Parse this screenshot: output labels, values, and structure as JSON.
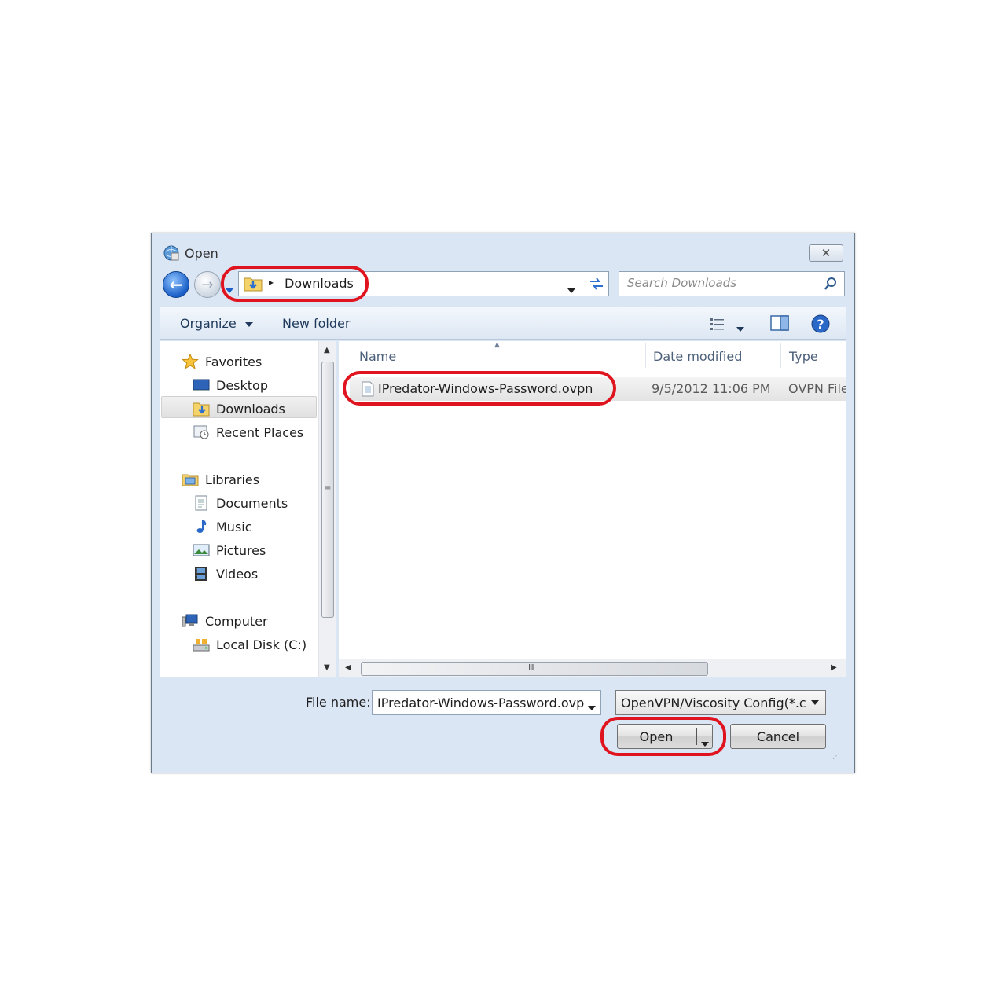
{
  "window": {
    "title": "Open"
  },
  "address": {
    "crumb_separator": "▸",
    "current_folder": "Downloads"
  },
  "search": {
    "placeholder": "Search Downloads"
  },
  "toolbar": {
    "organize_label": "Organize",
    "new_folder_label": "New folder"
  },
  "nav": {
    "groups": [
      {
        "label": "Favorites",
        "items": [
          "Desktop",
          "Downloads",
          "Recent Places"
        ]
      },
      {
        "label": "Libraries",
        "items": [
          "Documents",
          "Music",
          "Pictures",
          "Videos"
        ]
      },
      {
        "label": "Computer",
        "items": [
          "Local Disk (C:)"
        ]
      }
    ]
  },
  "columns": {
    "name": "Name",
    "date": "Date modified",
    "type": "Type"
  },
  "files": [
    {
      "name": "IPredator-Windows-Password.ovpn",
      "date": "9/5/2012 11:06 PM",
      "type": "OVPN File"
    }
  ],
  "footer": {
    "filename_label": "File name:",
    "filename_value": "IPredator-Windows-Password.ovp",
    "filetype_value": "OpenVPN/Viscosity Config(*.cc",
    "open_label": "Open",
    "cancel_label": "Cancel"
  },
  "colors": {
    "highlight_ring": "#e0141e",
    "accent": "#1a5fc7"
  }
}
